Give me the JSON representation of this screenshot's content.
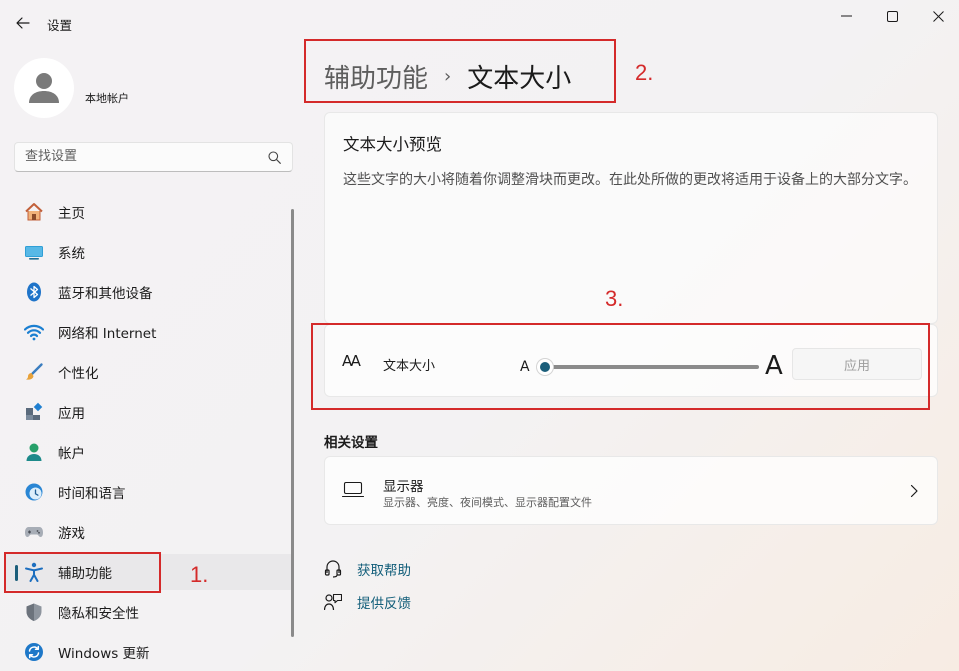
{
  "window": {
    "title": "设置",
    "back_icon": "back-arrow-icon",
    "controls": [
      "minimize-icon",
      "maximize-icon",
      "close-icon"
    ]
  },
  "account": {
    "name": "本地帐户"
  },
  "search": {
    "placeholder": "查找设置"
  },
  "sidebar": {
    "items": [
      {
        "label": "主页",
        "icon": "home-icon"
      },
      {
        "label": "系统",
        "icon": "system-icon"
      },
      {
        "label": "蓝牙和其他设备",
        "icon": "bluetooth-icon"
      },
      {
        "label": "网络和 Internet",
        "icon": "wifi-icon"
      },
      {
        "label": "个性化",
        "icon": "brush-icon"
      },
      {
        "label": "应用",
        "icon": "apps-icon"
      },
      {
        "label": "帐户",
        "icon": "account-icon"
      },
      {
        "label": "时间和语言",
        "icon": "clock-globe-icon"
      },
      {
        "label": "游戏",
        "icon": "gamepad-icon"
      },
      {
        "label": "辅助功能",
        "icon": "accessibility-icon",
        "selected": true
      },
      {
        "label": "隐私和安全性",
        "icon": "shield-icon"
      },
      {
        "label": "Windows 更新",
        "icon": "update-icon"
      }
    ]
  },
  "breadcrumb": {
    "parent": "辅助功能",
    "separator": "›",
    "current": "文本大小"
  },
  "preview": {
    "title": "文本大小预览",
    "text": "这些文字的大小将随着你调整滑块而更改。在此处所做的更改将适用于设备上的大部分文字。"
  },
  "text_size": {
    "label": "文本大小",
    "small_a": "A",
    "big_a": "A",
    "icon_text": "AA",
    "slider_value_percent": 0,
    "apply_label": "应用"
  },
  "related": {
    "title": "相关设置",
    "display": {
      "title": "显示器",
      "subtitle": "显示器、亮度、夜间模式、显示器配置文件"
    }
  },
  "help": {
    "get_help": "获取帮助",
    "feedback": "提供反馈"
  },
  "annotations": {
    "one": "1.",
    "two": "2.",
    "three": "3.",
    "color": "#d42a2a"
  },
  "colors": {
    "accent": "#1b5e7a",
    "link": "#125e7a"
  }
}
